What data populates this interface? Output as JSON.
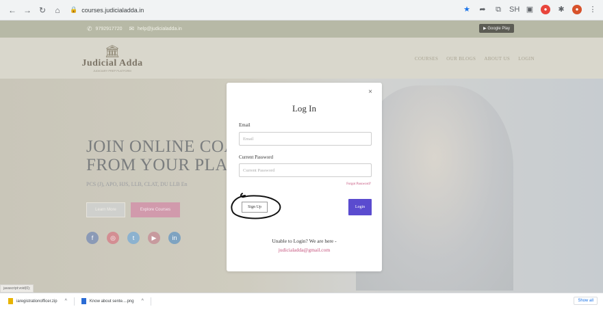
{
  "browser": {
    "nav": {
      "back": "←",
      "forward": "→",
      "reload": "↻",
      "home": "⌂"
    },
    "url": "courses.judicialadda.in",
    "lock_icon": "🔒",
    "extensions": [
      "★",
      "➦",
      "⧉",
      "SH",
      "▣",
      "●",
      "✱",
      "●",
      "⋮"
    ]
  },
  "topbar": {
    "phone": "9792917720",
    "email": "help@judicialadda.in",
    "google_play": "Google Play"
  },
  "site": {
    "logo_text": "Judicial Adda",
    "logo_tagline": "JUDICIARY PREP PLATFORM",
    "menu": [
      "COURSES",
      "OUR BLOGS",
      "ABOUT US",
      "LOGIN"
    ]
  },
  "hero": {
    "title_line1": "JOIN ONLINE COAC",
    "title_line2": "FROM YOUR PLACE",
    "subtitle": "PCS (J), APO, HJS, LLB, CLAT, DU LLB En",
    "learn_more": "Learn More",
    "explore": "Explore Courses"
  },
  "modal": {
    "close": "×",
    "title": "Log In",
    "email_label": "Email",
    "email_placeholder": "Email",
    "password_label": "Current Password",
    "password_placeholder": "Current Password",
    "forgot": "Forgot Password?",
    "signup": "Sign Up",
    "login": "Login",
    "help_text": "Unable to Login? We are here -",
    "help_email": "judicialadda@gmail.com"
  },
  "status_hint": "javascript:void(0);",
  "downloads": {
    "items": [
      "iaregistrationofficer.zip",
      "Know about sente....png"
    ],
    "caret": "^",
    "show_all": "Show all"
  }
}
